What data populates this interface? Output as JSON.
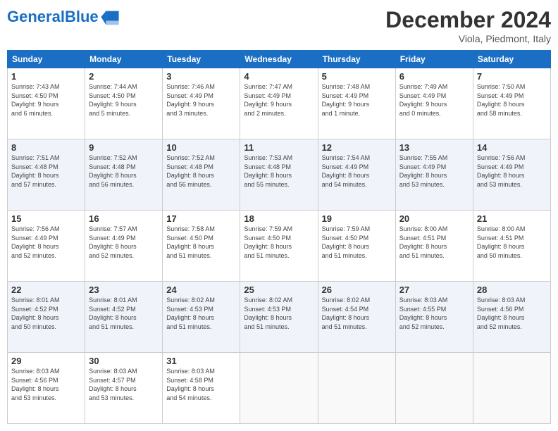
{
  "header": {
    "logo_general": "General",
    "logo_blue": "Blue",
    "month": "December 2024",
    "location": "Viola, Piedmont, Italy"
  },
  "days_of_week": [
    "Sunday",
    "Monday",
    "Tuesday",
    "Wednesday",
    "Thursday",
    "Friday",
    "Saturday"
  ],
  "weeks": [
    [
      {
        "day": "1",
        "info": "Sunrise: 7:43 AM\nSunset: 4:50 PM\nDaylight: 9 hours\nand 6 minutes."
      },
      {
        "day": "2",
        "info": "Sunrise: 7:44 AM\nSunset: 4:50 PM\nDaylight: 9 hours\nand 5 minutes."
      },
      {
        "day": "3",
        "info": "Sunrise: 7:46 AM\nSunset: 4:49 PM\nDaylight: 9 hours\nand 3 minutes."
      },
      {
        "day": "4",
        "info": "Sunrise: 7:47 AM\nSunset: 4:49 PM\nDaylight: 9 hours\nand 2 minutes."
      },
      {
        "day": "5",
        "info": "Sunrise: 7:48 AM\nSunset: 4:49 PM\nDaylight: 9 hours\nand 1 minute."
      },
      {
        "day": "6",
        "info": "Sunrise: 7:49 AM\nSunset: 4:49 PM\nDaylight: 9 hours\nand 0 minutes."
      },
      {
        "day": "7",
        "info": "Sunrise: 7:50 AM\nSunset: 4:49 PM\nDaylight: 8 hours\nand 58 minutes."
      }
    ],
    [
      {
        "day": "8",
        "info": "Sunrise: 7:51 AM\nSunset: 4:48 PM\nDaylight: 8 hours\nand 57 minutes."
      },
      {
        "day": "9",
        "info": "Sunrise: 7:52 AM\nSunset: 4:48 PM\nDaylight: 8 hours\nand 56 minutes."
      },
      {
        "day": "10",
        "info": "Sunrise: 7:52 AM\nSunset: 4:48 PM\nDaylight: 8 hours\nand 56 minutes."
      },
      {
        "day": "11",
        "info": "Sunrise: 7:53 AM\nSunset: 4:48 PM\nDaylight: 8 hours\nand 55 minutes."
      },
      {
        "day": "12",
        "info": "Sunrise: 7:54 AM\nSunset: 4:49 PM\nDaylight: 8 hours\nand 54 minutes."
      },
      {
        "day": "13",
        "info": "Sunrise: 7:55 AM\nSunset: 4:49 PM\nDaylight: 8 hours\nand 53 minutes."
      },
      {
        "day": "14",
        "info": "Sunrise: 7:56 AM\nSunset: 4:49 PM\nDaylight: 8 hours\nand 53 minutes."
      }
    ],
    [
      {
        "day": "15",
        "info": "Sunrise: 7:56 AM\nSunset: 4:49 PM\nDaylight: 8 hours\nand 52 minutes."
      },
      {
        "day": "16",
        "info": "Sunrise: 7:57 AM\nSunset: 4:49 PM\nDaylight: 8 hours\nand 52 minutes."
      },
      {
        "day": "17",
        "info": "Sunrise: 7:58 AM\nSunset: 4:50 PM\nDaylight: 8 hours\nand 51 minutes."
      },
      {
        "day": "18",
        "info": "Sunrise: 7:59 AM\nSunset: 4:50 PM\nDaylight: 8 hours\nand 51 minutes."
      },
      {
        "day": "19",
        "info": "Sunrise: 7:59 AM\nSunset: 4:50 PM\nDaylight: 8 hours\nand 51 minutes."
      },
      {
        "day": "20",
        "info": "Sunrise: 8:00 AM\nSunset: 4:51 PM\nDaylight: 8 hours\nand 51 minutes."
      },
      {
        "day": "21",
        "info": "Sunrise: 8:00 AM\nSunset: 4:51 PM\nDaylight: 8 hours\nand 50 minutes."
      }
    ],
    [
      {
        "day": "22",
        "info": "Sunrise: 8:01 AM\nSunset: 4:52 PM\nDaylight: 8 hours\nand 50 minutes."
      },
      {
        "day": "23",
        "info": "Sunrise: 8:01 AM\nSunset: 4:52 PM\nDaylight: 8 hours\nand 51 minutes."
      },
      {
        "day": "24",
        "info": "Sunrise: 8:02 AM\nSunset: 4:53 PM\nDaylight: 8 hours\nand 51 minutes."
      },
      {
        "day": "25",
        "info": "Sunrise: 8:02 AM\nSunset: 4:53 PM\nDaylight: 8 hours\nand 51 minutes."
      },
      {
        "day": "26",
        "info": "Sunrise: 8:02 AM\nSunset: 4:54 PM\nDaylight: 8 hours\nand 51 minutes."
      },
      {
        "day": "27",
        "info": "Sunrise: 8:03 AM\nSunset: 4:55 PM\nDaylight: 8 hours\nand 52 minutes."
      },
      {
        "day": "28",
        "info": "Sunrise: 8:03 AM\nSunset: 4:56 PM\nDaylight: 8 hours\nand 52 minutes."
      }
    ],
    [
      {
        "day": "29",
        "info": "Sunrise: 8:03 AM\nSunset: 4:56 PM\nDaylight: 8 hours\nand 53 minutes."
      },
      {
        "day": "30",
        "info": "Sunrise: 8:03 AM\nSunset: 4:57 PM\nDaylight: 8 hours\nand 53 minutes."
      },
      {
        "day": "31",
        "info": "Sunrise: 8:03 AM\nSunset: 4:58 PM\nDaylight: 8 hours\nand 54 minutes."
      },
      {
        "day": "",
        "info": ""
      },
      {
        "day": "",
        "info": ""
      },
      {
        "day": "",
        "info": ""
      },
      {
        "day": "",
        "info": ""
      }
    ]
  ]
}
